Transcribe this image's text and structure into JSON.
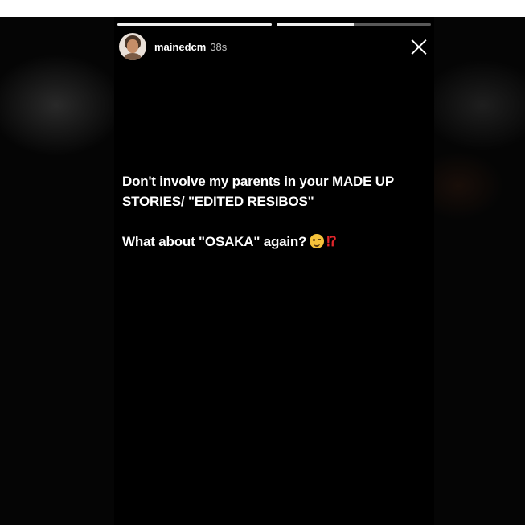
{
  "story": {
    "progress": [
      1.0,
      0.5
    ],
    "user": {
      "username": "mainedcm",
      "time_ago": "38s",
      "avatar_icon": "avatar-bitmoji-icon"
    },
    "close_icon": "close-icon",
    "message": {
      "line1": "Don't involve my parents in your MADE UP STORIES/ \"EDITED RESIBOS\"",
      "line2": "What about \"OSAKA\" again?",
      "emoji_wink": "winking-face-emoji",
      "emoji_exclaim": "⁉"
    }
  },
  "colors": {
    "background": "#000000",
    "text": "#ffffff",
    "exclaim": "#e0262b"
  }
}
